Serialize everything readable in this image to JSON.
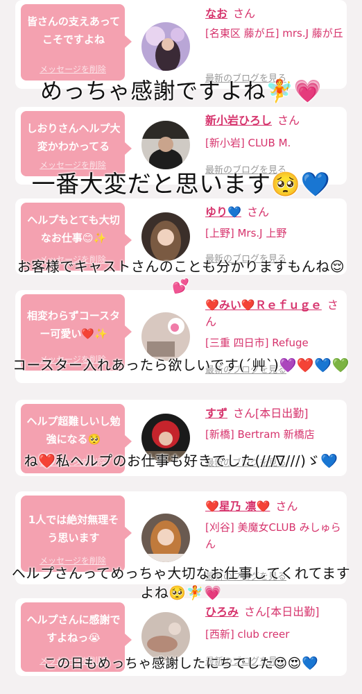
{
  "cards": [
    {
      "bubble": "皆さんの支えあってこそですよね",
      "delete": "メッセージを削除",
      "name": "なお",
      "san": "さん",
      "shop": "[名東区 藤が丘] mrs.J 藤が丘",
      "blog": "最新のブログを見る"
    },
    {
      "bubble": "しおりさんヘルプ大変かわかってる",
      "delete": "メッセージを削除",
      "name": "新小岩ひろし",
      "san": "さん",
      "shop": "[新小岩] CLUB M.",
      "blog": "最新のブログを見る"
    },
    {
      "bubble": "ヘルプもとても大切なお仕事😊✨",
      "delete": "メッセージを削除",
      "name": "ゆり💙",
      "san": "さん",
      "shop": "[上野] Mrs.J 上野",
      "blog": "最新のブログを見る"
    },
    {
      "bubble": "相変わらずコースター可愛い❤️✨",
      "delete": "メッセージを削除",
      "name": "❤️みい❤️Ｒｅｆｕｇｅ",
      "san": "さん",
      "shop": "[三重 四日市] Refuge",
      "blog": "最新のブログを見る"
    },
    {
      "bubble": "ヘルプ超難しいし勉強になる🥺",
      "delete": "メッセージを削除",
      "name": "すず",
      "san": "さん[本日出勤]",
      "shop": "[新橋] Bertram 新橋店",
      "blog": "最新のブログを見る"
    },
    {
      "bubble": "1人では絶対無理そう思います",
      "delete": "メッセージを削除",
      "name": "❤️星乃 凛❤️",
      "san": "さん",
      "shop": "[刈谷] 美魔女CLUB みしゅらん",
      "blog": "最新のブログを見る"
    },
    {
      "bubble": "ヘルプさんに感謝ですよねっ😭",
      "delete": "メッセージを削除",
      "name": "ひろみ",
      "san": "さん[本日出勤]",
      "shop": "[西新] club creer",
      "blog": "最新のブログを見る"
    }
  ],
  "overlays": [
    "めっちゃ感謝ですよね🧚💗",
    "一番大変だと思います🥺💙",
    "お客様でキャストさんのことも分かりますもんね😌💕",
    "コースター入れあったら欲しいです(´艸`)💜❤️💙💚",
    "ね❤️私ヘルプのお仕事も好きでした(///∇///)ゞ💙",
    "ヘルプさんってめっちゃ大切なお仕事してくれてますよね🥺🧚💗",
    "この日もめっちゃ感謝したにちでした😍😍💙"
  ],
  "colors": {
    "accent": "#d6336c",
    "bubble": "#f4a1b0",
    "background": "#f4f1f2"
  }
}
